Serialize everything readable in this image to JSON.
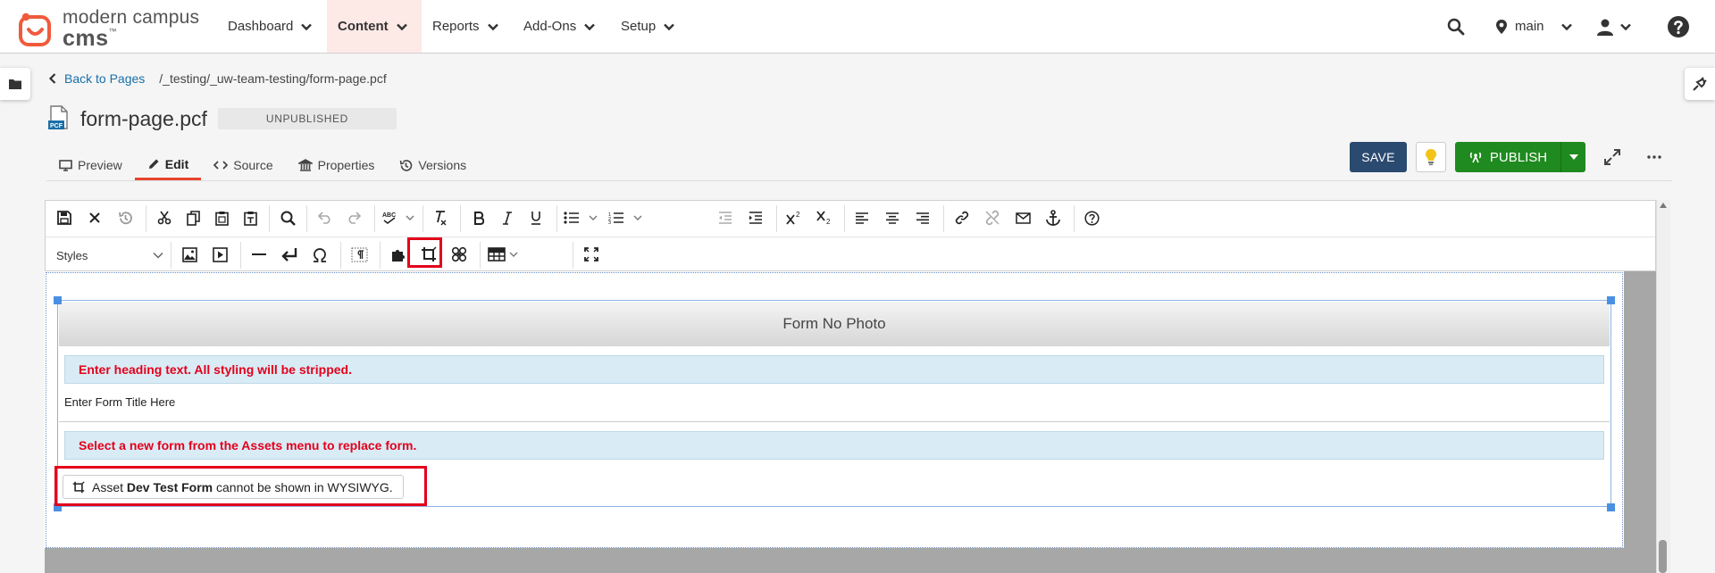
{
  "brand": {
    "line1": "modern campus",
    "line2": "cms",
    "tm": "™",
    "accent": "#f05a3c"
  },
  "nav": {
    "items": [
      {
        "label": "Dashboard"
      },
      {
        "label": "Content"
      },
      {
        "label": "Reports"
      },
      {
        "label": "Add-Ons"
      },
      {
        "label": "Setup"
      }
    ],
    "site_label": "main"
  },
  "breadcrumb": {
    "back_label": "Back to Pages",
    "path": "/_testing/_uw-team-testing/form-page.pcf"
  },
  "page": {
    "title": "form-page.pcf",
    "status": "UNPUBLISHED",
    "file_badge": "PCF"
  },
  "tabs": [
    {
      "label": "Preview"
    },
    {
      "label": "Edit"
    },
    {
      "label": "Source"
    },
    {
      "label": "Properties"
    },
    {
      "label": "Versions"
    }
  ],
  "actions": {
    "save_label": "SAVE",
    "publish_label": "PUBLISH"
  },
  "toolbar": {
    "styles_label": "Styles"
  },
  "editor": {
    "widget_title": "Form No Photo",
    "heading_hint": "Enter heading text. All styling will be stripped.",
    "heading_value": "Enter Form Title Here",
    "form_hint": "Select a new form from the Assets menu to replace form.",
    "asset_prefix": "Asset",
    "asset_name": "Dev Test Form",
    "asset_suffix": "cannot be shown in WYSIWYG."
  },
  "colors": {
    "save": "#2b4a70",
    "publish": "#1f8a1f",
    "highlight": "#e3001b",
    "hint_text": "#e3001b"
  }
}
